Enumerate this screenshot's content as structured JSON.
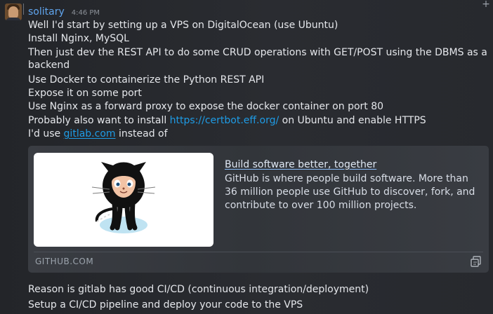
{
  "message": {
    "username": "solitary",
    "timestamp": "4:46 PM",
    "lines": [
      "Well I'd start by setting up a VPS on DigitalOcean (use Ubuntu)",
      "Install Nginx, MySQL",
      "Then just dev the REST API to do some CRUD operations with GET/POST using the DBMS as a",
      "backend",
      "Use Docker to containerize the Python REST API",
      "Expose it on some port",
      "Use Nginx as a forward proxy to expose the docker container on port 80"
    ],
    "certbot_line": {
      "before": "Probably also want to install ",
      "link": "https://certbot.eff.org/",
      "after": " on Ubuntu and enable HTTPS"
    },
    "gitlab_line": {
      "before": "I'd use ",
      "link": "gitlab.com",
      "after": " instead of"
    },
    "after_lines": [
      "Reason is gitlab has good CI/CD (continuous integration/deployment)",
      "Setup a CI/CD pipeline and deploy your code to the VPS"
    ]
  },
  "embed": {
    "title": "Build software better, together",
    "description": "GitHub is where people build software. More than 36 million people use GitHub to discover, fork, and contribute to over 100 million projects.",
    "domain": "GITHUB.COM",
    "image_icon": "octocat-image"
  },
  "icons": {
    "plus": "+",
    "copy": "copy-icon"
  },
  "colors": {
    "background": "#25272b",
    "username": "#60a5ee",
    "link": "#1e9ce6",
    "text": "#e5e7eb"
  }
}
